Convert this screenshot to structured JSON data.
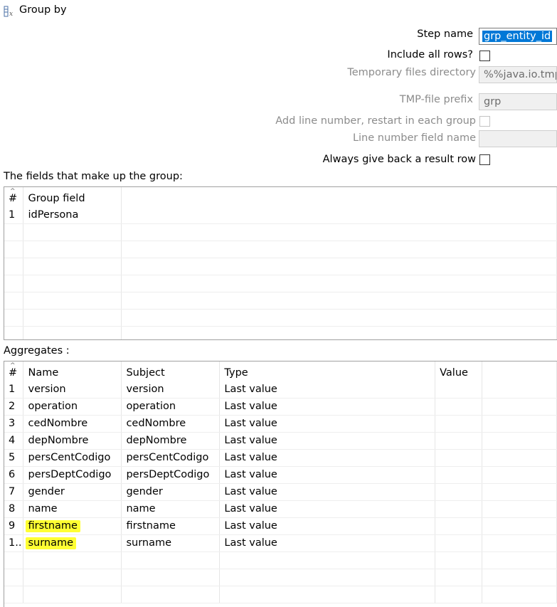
{
  "window": {
    "title": "Group by",
    "icon": "group-by-icon"
  },
  "form": {
    "step_name_label": "Step name",
    "step_name_value": "grp_entity_id",
    "include_all_rows_label": "Include all rows?",
    "include_all_rows_checked": false,
    "temp_dir_label": "Temporary files directory",
    "temp_dir_value": "%%java.io.tmpdir%%",
    "tmp_prefix_label": "TMP-file prefix",
    "tmp_prefix_value": "grp",
    "add_line_number_label": "Add line number, restart in each group",
    "add_line_number_checked": false,
    "line_number_field_label": "Line number field name",
    "line_number_field_value": "",
    "always_result_label": "Always give back a result row",
    "always_result_checked": false
  },
  "group_fields": {
    "section_label": "The fields that make up the group:",
    "columns": [
      "#",
      "Group field"
    ],
    "rows": [
      {
        "num": "1",
        "field": "idPersona"
      }
    ]
  },
  "aggregates": {
    "section_label": "Aggregates :",
    "columns": [
      "#",
      "Name",
      "Subject",
      "Type",
      "Value"
    ],
    "rows": [
      {
        "num": "1",
        "name": "version",
        "subject": "version",
        "type": "Last value",
        "value": ""
      },
      {
        "num": "2",
        "name": "operation",
        "subject": "operation",
        "type": "Last value",
        "value": ""
      },
      {
        "num": "3",
        "name": "cedNombre",
        "subject": "cedNombre",
        "type": "Last value",
        "value": ""
      },
      {
        "num": "4",
        "name": "depNombre",
        "subject": "depNombre",
        "type": "Last value",
        "value": ""
      },
      {
        "num": "5",
        "name": "persCentCodigo",
        "subject": "persCentCodigo",
        "type": "Last value",
        "value": ""
      },
      {
        "num": "6",
        "name": "persDeptCodigo",
        "subject": "persDeptCodigo",
        "type": "Last value",
        "value": ""
      },
      {
        "num": "7",
        "name": "gender",
        "subject": "gender",
        "type": "Last value",
        "value": ""
      },
      {
        "num": "8",
        "name": "name",
        "subject": "name",
        "type": "Last value",
        "value": ""
      },
      {
        "num": "9",
        "name": "firstname",
        "subject": "firstname",
        "type": "Last value",
        "value": "",
        "highlighted": true
      },
      {
        "num": "1..",
        "name": "surname",
        "subject": "surname",
        "type": "Last value",
        "value": "",
        "highlighted": true
      }
    ]
  },
  "colors": {
    "highlight": "#ffff33",
    "selection": "#0078d7"
  }
}
